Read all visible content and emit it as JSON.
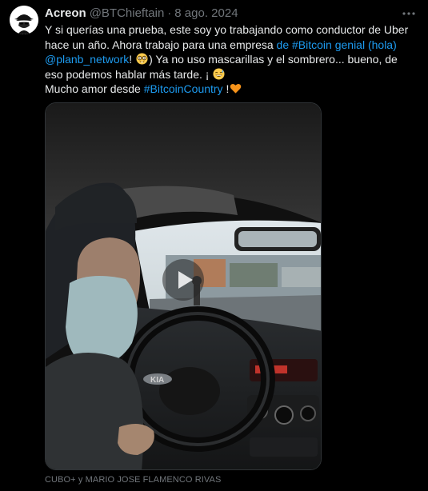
{
  "tweet": {
    "author": {
      "display_name": "Acreon",
      "handle": "@BTChieftain",
      "avatar_icon": "detective-hat-avatar-icon"
    },
    "separator": "·",
    "date": "8 ago. 2024",
    "more_icon": "more-options-icon",
    "text": {
      "line1": "Y si querías una prueba, este soy yo trabajando como conductor de Uber hace un año. Ahora trabajo para una empresa ",
      "link1": "de #Bitcoin genial (hola)",
      "space": " ",
      "link2": "@planb_network",
      "after_link2": "! ",
      "after_emoji1": ") Ya no uso mascarillas y el sombrero... bueno, de eso podemos hablar más tarde. ¡ ",
      "line3_prefix": "Mucho amor desde ",
      "link3": "#BitcoinCountry",
      "after_link3": " !",
      "emoji1": "nerd-face-emoji",
      "emoji2": "grinning-sweat-emoji",
      "emoji3": "orange-heart-emoji"
    },
    "media": {
      "type": "video",
      "play_icon": "play-icon"
    },
    "credit": "CUBO+ y MARIO JOSE FLAMENCO RIVAS"
  },
  "colors": {
    "background": "#000000",
    "text": "#e7e9ea",
    "secondary": "#71767b",
    "link": "#1d9bf0",
    "heart": "#f7931a"
  }
}
